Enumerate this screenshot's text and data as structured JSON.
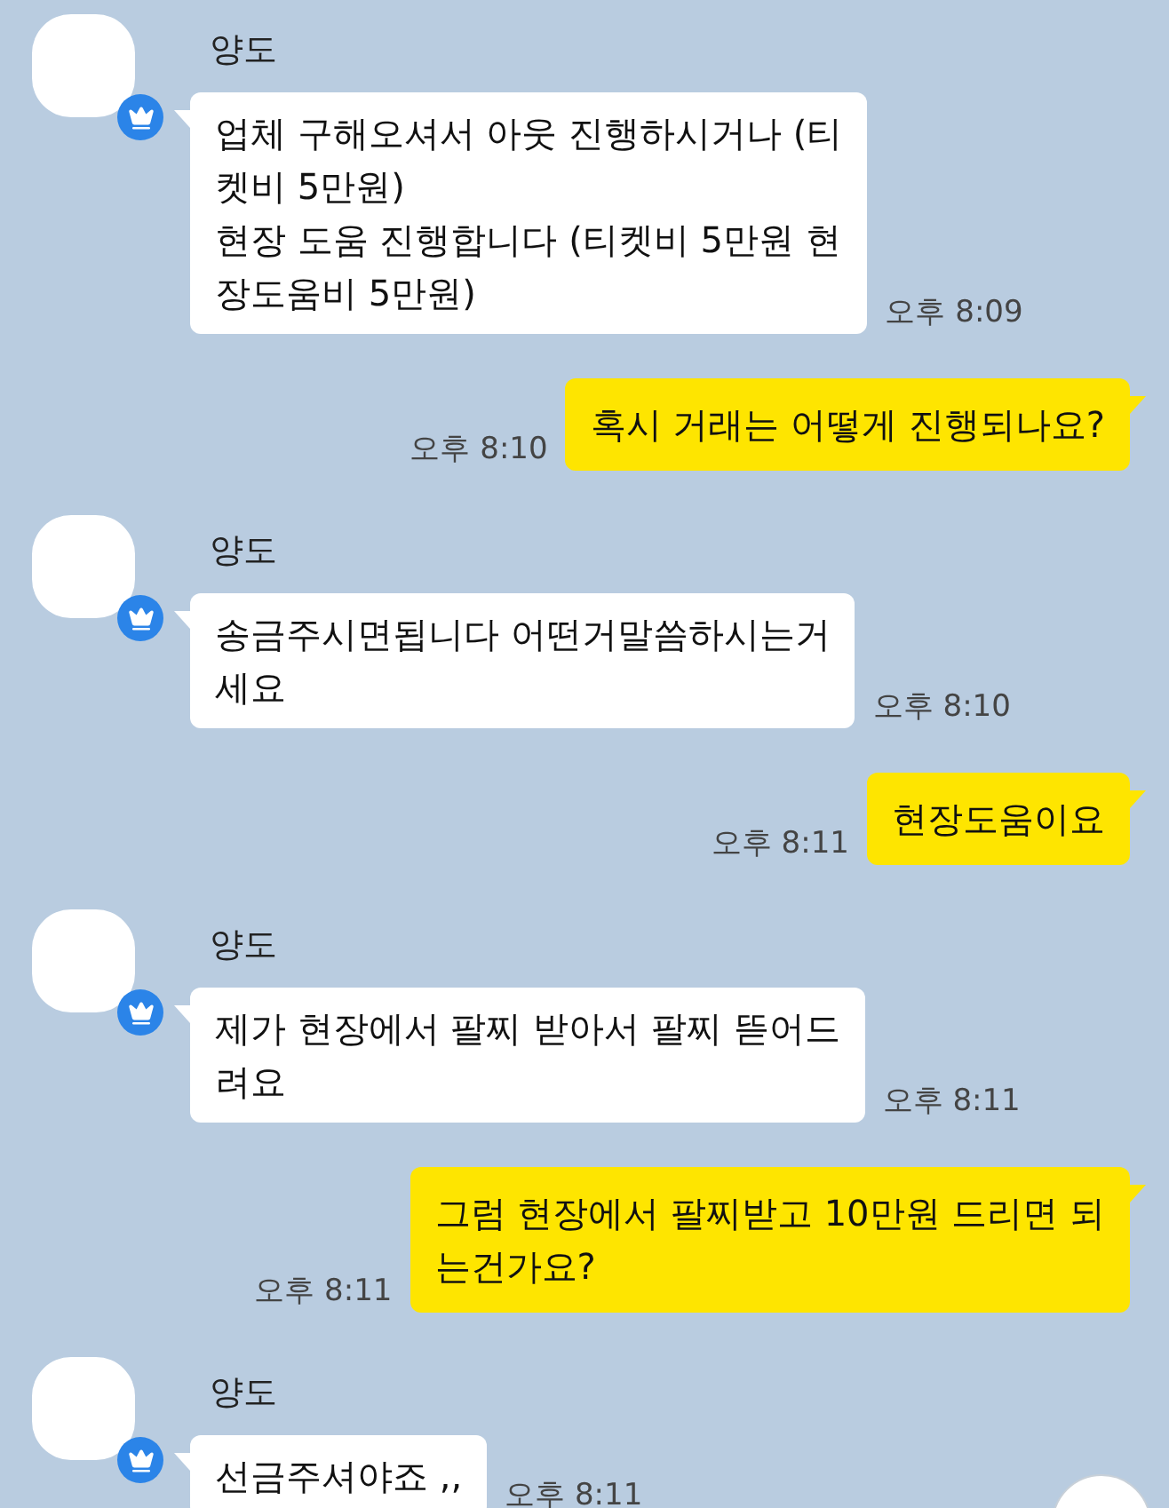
{
  "messages": [
    {
      "kind": "incoming",
      "sender": "양도",
      "lines": [
        "업체 구해오셔서 아웃 진행하시거나 (티",
        "켓비 5만원)",
        "현장 도움 진행합니다 (티켓비 5만원 현",
        "장도움비 5만원)"
      ],
      "time": "오후 8:09"
    },
    {
      "kind": "outgoing",
      "lines": [
        "혹시 거래는 어떻게 진행되나요?"
      ],
      "time": "오후 8:10"
    },
    {
      "kind": "incoming",
      "sender": "양도",
      "lines": [
        "송금주시면됩니다 어떤거말씀하시는거",
        "세요"
      ],
      "time": "오후 8:10"
    },
    {
      "kind": "outgoing",
      "lines": [
        "현장도움이요"
      ],
      "time": "오후 8:11"
    },
    {
      "kind": "incoming",
      "sender": "양도",
      "lines": [
        "제가 현장에서 팔찌 받아서 팔찌 뜯어드",
        "려요"
      ],
      "time": "오후 8:11"
    },
    {
      "kind": "outgoing",
      "lines": [
        "그럼 현장에서 팔찌받고 10만원 드리면 되",
        "는건가요?"
      ],
      "time": "오후 8:11"
    },
    {
      "kind": "incoming",
      "sender": "양도",
      "lines": [
        "선금주셔야죠 ,,"
      ],
      "time": "오후 8:11"
    }
  ]
}
